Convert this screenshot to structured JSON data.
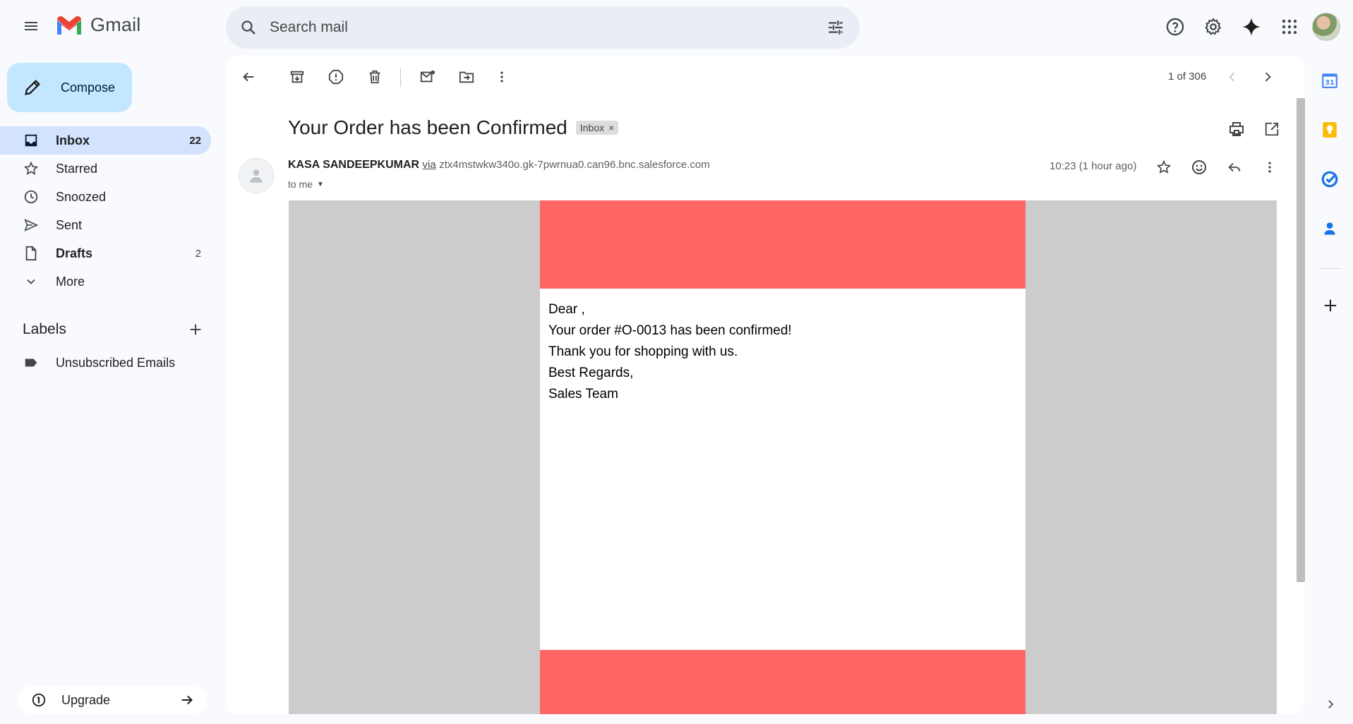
{
  "app": {
    "name": "Gmail"
  },
  "search": {
    "placeholder": "Search mail"
  },
  "sidebar": {
    "compose_label": "Compose",
    "items": [
      {
        "label": "Inbox",
        "count": "22"
      },
      {
        "label": "Starred",
        "count": ""
      },
      {
        "label": "Snoozed",
        "count": ""
      },
      {
        "label": "Sent",
        "count": ""
      },
      {
        "label": "Drafts",
        "count": "2"
      },
      {
        "label": "More",
        "count": ""
      }
    ],
    "labels_title": "Labels",
    "labels": [
      {
        "label": "Unsubscribed Emails"
      }
    ],
    "upgrade_label": "Upgrade"
  },
  "toolbar": {
    "pager": "1 of 306"
  },
  "message": {
    "subject": "Your Order has been Confirmed",
    "chip": "Inbox",
    "chip_close": "×",
    "sender_name": "KASA SANDEEPKUMAR",
    "via": "via",
    "sender_address": "ztx4mstwkw340o.gk-7pwrnua0.can96.bnc.salesforce.com",
    "to": "to me",
    "time": "10:23 (1 hour ago)",
    "body_lines": [
      "Dear ,",
      "Your order #O-0013 has been confirmed!",
      "Thank you for shopping with us.",
      "Best Regards,",
      "Sales Team"
    ]
  },
  "colors": {
    "accent": "#c2e7ff",
    "active_nav": "#d3e3fd",
    "email_banner": "#ff6666",
    "email_backdrop": "#cccccc"
  }
}
